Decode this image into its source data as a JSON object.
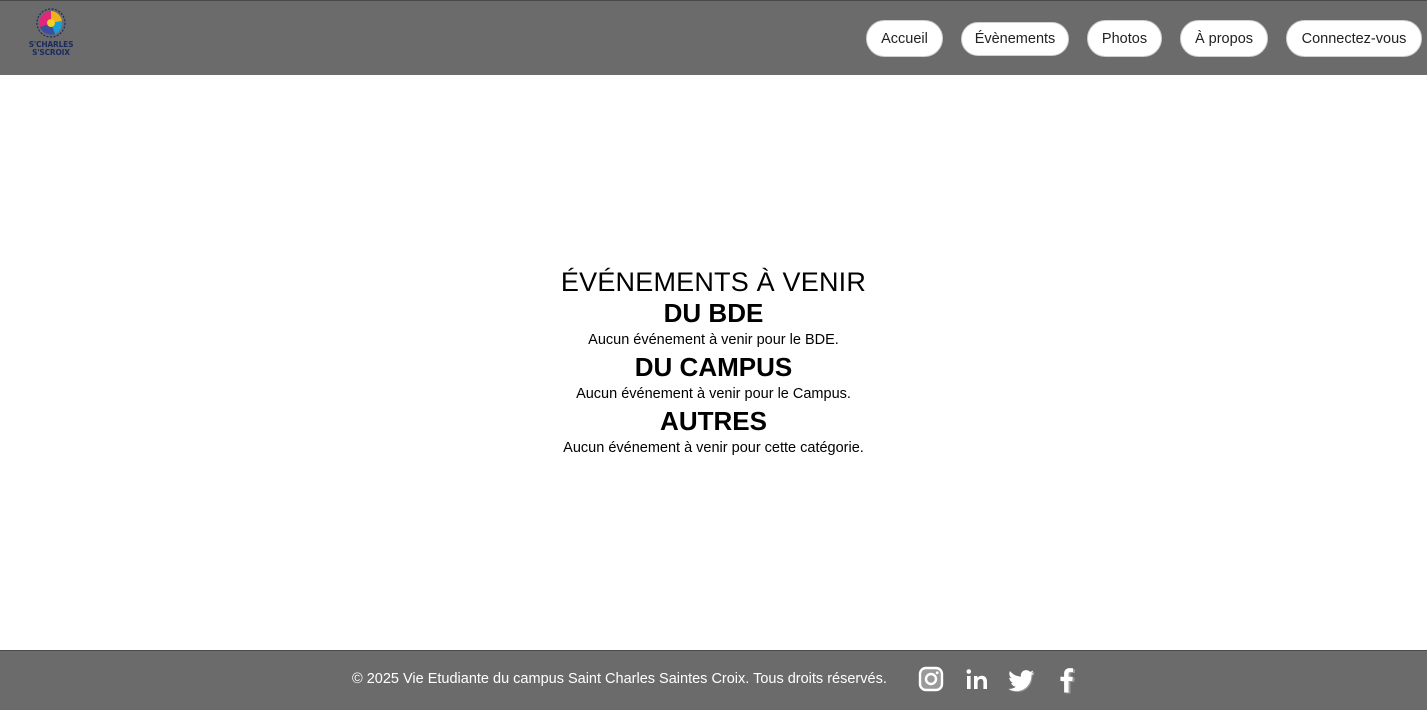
{
  "header": {
    "logo": {
      "line1": "S'CHARLES",
      "line2": "S'SCROIX"
    },
    "nav": [
      {
        "label": "Accueil"
      },
      {
        "label": "Évènements"
      },
      {
        "label": "Photos"
      },
      {
        "label": "À propos"
      },
      {
        "label": "Connectez-vous"
      }
    ]
  },
  "main": {
    "title": "ÉVÉNEMENTS À VENIR",
    "sections": [
      {
        "title": "DU BDE",
        "empty_text": "Aucun événement à venir pour le BDE."
      },
      {
        "title": "DU CAMPUS",
        "empty_text": "Aucun événement à venir pour le Campus."
      },
      {
        "title": "AUTRES",
        "empty_text": "Aucun événement à venir pour cette catégorie."
      }
    ]
  },
  "footer": {
    "copyright": "© 2025 Vie Etudiante du campus Saint Charles Saintes Croix. Tous droits réservés.",
    "social": [
      "instagram-icon",
      "linkedin-icon",
      "twitter-icon",
      "facebook-icon"
    ]
  },
  "colors": {
    "bar": "#6b6b6b",
    "button_bg": "#ffffff",
    "text": "#000000",
    "footer_text": "#ffffff",
    "logo_blue": "#1d2a5e"
  }
}
